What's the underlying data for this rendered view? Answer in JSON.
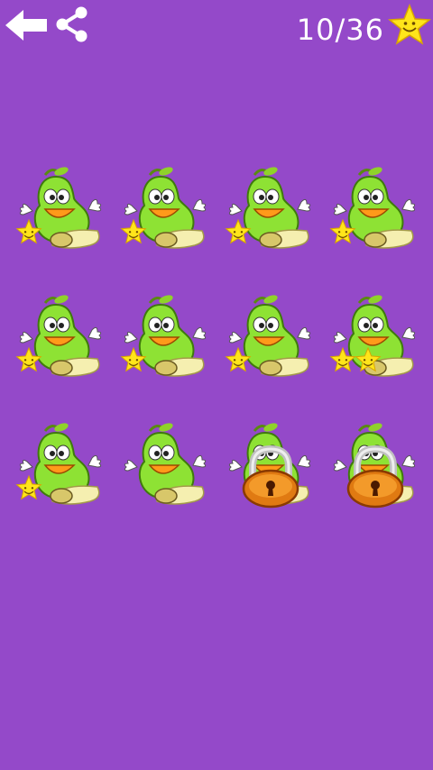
{
  "header": {
    "back_icon": "back-arrow-icon",
    "share_icon": "share-icon",
    "score_text": "10/36",
    "score_icon": "smiling-star-icon"
  },
  "colors": {
    "background": "#9449c9",
    "pear_green": "#8ee234",
    "star_yellow": "#ffe51a",
    "lock_orange": "#e07a12"
  },
  "levels": [
    {
      "stars": 1,
      "locked": false
    },
    {
      "stars": 1,
      "locked": false
    },
    {
      "stars": 1,
      "locked": false
    },
    {
      "stars": 1,
      "locked": false
    },
    {
      "stars": 1,
      "locked": false
    },
    {
      "stars": 1,
      "locked": false
    },
    {
      "stars": 1,
      "locked": false
    },
    {
      "stars": 2,
      "locked": false
    },
    {
      "stars": 1,
      "locked": false
    },
    {
      "stars": 0,
      "locked": false
    },
    {
      "stars": 0,
      "locked": true
    },
    {
      "stars": 0,
      "locked": true
    }
  ]
}
